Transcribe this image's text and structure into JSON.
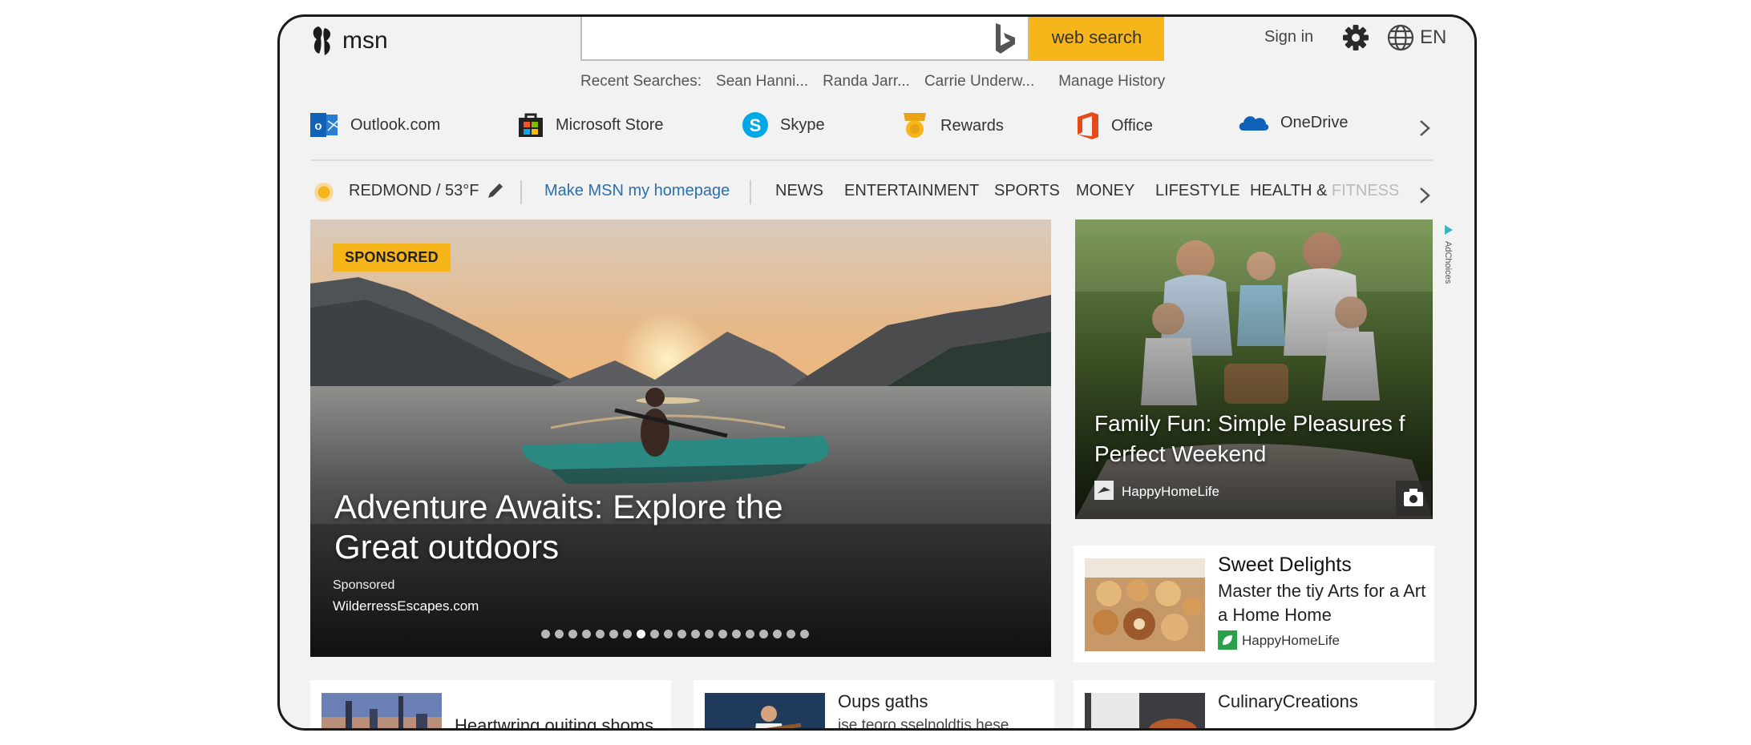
{
  "header": {
    "logo_text": "msn",
    "search_button": "web search",
    "sign_in": "Sign in",
    "language": "EN",
    "recent_label": "Recent Searches:",
    "recent_items": [
      "Sean Hanni...",
      "Randa Jarr...",
      "Carrie Underw..."
    ],
    "manage_history": "Manage History"
  },
  "apps": [
    {
      "label": "Outlook.com",
      "icon": "outlook-icon"
    },
    {
      "label": "Microsoft Store",
      "icon": "store-icon"
    },
    {
      "label": "Skype",
      "icon": "skype-icon"
    },
    {
      "label": "Rewards",
      "icon": "rewards-icon"
    },
    {
      "label": "Office",
      "icon": "office-icon"
    },
    {
      "label": "OneDrive",
      "icon": "onedrive-icon"
    }
  ],
  "nav": {
    "weather": "REDMOND / 53°F",
    "homepage": "Make MSN my homepage",
    "categories": [
      "NEWS",
      "ENTERTAINMENT",
      "SPORTS",
      "MONEY",
      "LIFESTYLE"
    ],
    "health": "HEALTH &",
    "fitness": "FITNESS"
  },
  "hero": {
    "badge": "SPONSORED",
    "title": "Adventure Awaits: Explore the Great outdoors",
    "sponsored": "Sponsored",
    "source": "WilderressEscapes.com",
    "slide_count": 20,
    "active_slide": 7
  },
  "family_card": {
    "title_line1": "Family Fun: Simple Pleasures f",
    "title_line2": "Perfect Weekend",
    "source": "HappyHomeLife",
    "adchoices": "AdChoices"
  },
  "sweet_card": {
    "title": "Sweet Delights",
    "body": "Master the tiy Arts for a Art a Home Home",
    "source": "HappyHomeLife"
  },
  "bottom_cards": [
    {
      "title": "Heartwring ouiting shoms"
    },
    {
      "title": "Oups gaths",
      "subtitle": "ise teoro sselnoldtis hese"
    },
    {
      "title": "CulinaryCreations"
    }
  ],
  "colors": {
    "accent": "#f6b61a",
    "link": "#2a6fb0",
    "frame_bg": "#f2f2f2"
  }
}
